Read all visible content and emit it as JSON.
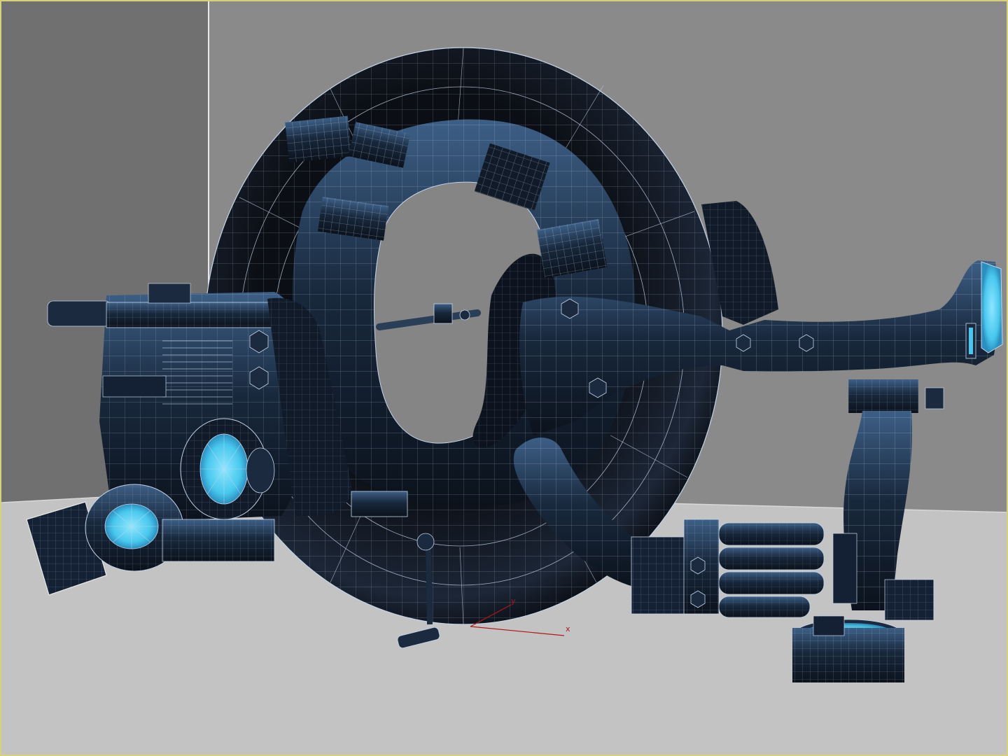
{
  "viewport": {
    "border_color": "#d6d27a",
    "selected_object_border_color": "#e8e8e8",
    "colors": {
      "back_wall": "#8a8a8a",
      "left_wall": "#6f6f6f",
      "floor": "#c2c2c2",
      "model_body": "#14202f",
      "model_highlight": "#3d5f86",
      "wireframe": "#c4d4e8",
      "glow": "#48c8ee",
      "axis": "#b01818"
    }
  },
  "axis_gizmo": {
    "x_label": "x",
    "y_label": "y"
  }
}
